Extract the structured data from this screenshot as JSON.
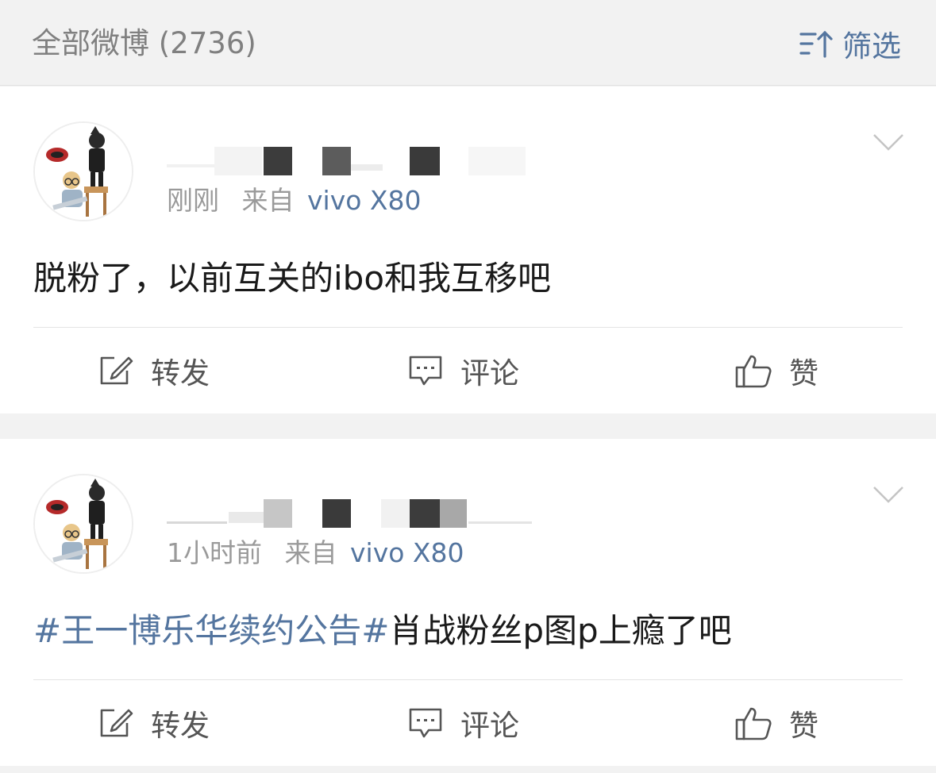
{
  "header": {
    "title": "全部微博 (2736)",
    "filter_label": "筛选"
  },
  "colors": {
    "link": "#54759f",
    "meta": "#9a9a9a",
    "text": "#1a1a1a",
    "background": "#f2f2f2"
  },
  "posts": [
    {
      "time": "刚刚",
      "source_prefix": "来自",
      "device": "vivo X80",
      "text": "脱粉了，以前互关的ibo和我互移吧",
      "hashtag": "",
      "actions": {
        "repost": "转发",
        "comment": "评论",
        "like": "赞"
      }
    },
    {
      "time": "1小时前",
      "source_prefix": "来自",
      "device": "vivo X80",
      "hashtag": "#王一博乐华续约公告#",
      "text": "肖战粉丝p图p上瘾了吧",
      "actions": {
        "repost": "转发",
        "comment": "评论",
        "like": "赞"
      }
    }
  ],
  "icons": {
    "filter": "filter-sort-icon",
    "menu": "chevron-down-icon",
    "repost": "repost-edit-icon",
    "comment": "comment-bubble-icon",
    "like": "thumbs-up-icon"
  }
}
